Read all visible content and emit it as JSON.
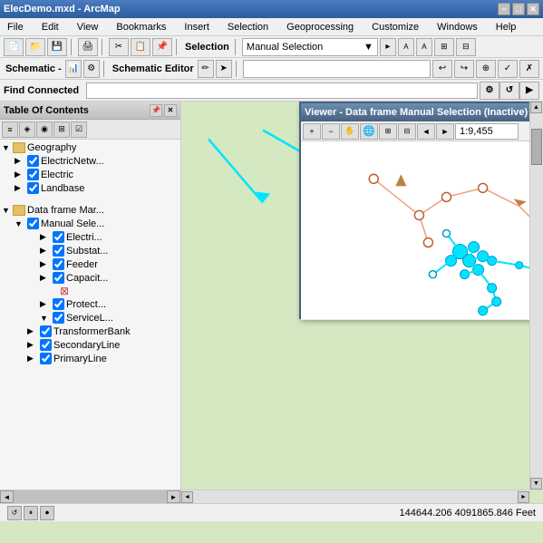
{
  "titleBar": {
    "title": "ElecDemo.mxd - ArcMap",
    "controls": [
      "_",
      "□",
      "×"
    ]
  },
  "menuBar": {
    "items": [
      "File",
      "Edit",
      "View",
      "Bookmarks",
      "Insert",
      "Selection",
      "Geoprocessing",
      "Customize",
      "Windows",
      "Help"
    ]
  },
  "toolbar1": {
    "dropdownLabel": "Manual Selection",
    "selectionLabel": "Selection"
  },
  "toolbar2": {
    "schematicLabel": "Schematic -",
    "editorLabel": "Schematic Editor"
  },
  "findConnected": {
    "label": "Find Connected"
  },
  "toc": {
    "title": "Table Of Contents",
    "geography": {
      "label": "Geography",
      "layers": [
        "ElectricNetw...",
        "Electric",
        "Landbase"
      ]
    },
    "dataFrame": {
      "label": "Data frame Mar...",
      "sublabel": "Manual Sele...",
      "layers": [
        "Electri...",
        "Substat...",
        "Feeder",
        "Capacit...",
        "Protect...",
        "ServiceL...",
        "TransformerBank",
        "SecondaryLine",
        "PrimaryLine"
      ]
    }
  },
  "viewer": {
    "title": "Viewer - Data frame Manual Selection (Inactive)",
    "scale": "1:9,455"
  },
  "statusBar": {
    "coordinates": "144644.206  4091865.846 Feet"
  },
  "icons": {
    "expand": "▶",
    "collapse": "▼",
    "close": "✕",
    "minimize": "−",
    "maximize": "□",
    "scrollUp": "▲",
    "scrollDown": "▼",
    "scrollLeft": "◄",
    "scrollRight": "►",
    "zoomIn": "+",
    "zoomOut": "−",
    "hand": "✋",
    "arrowLeft": "◄",
    "arrowRight": "►",
    "play": "►",
    "pause": "⏸",
    "record": "⏺"
  }
}
